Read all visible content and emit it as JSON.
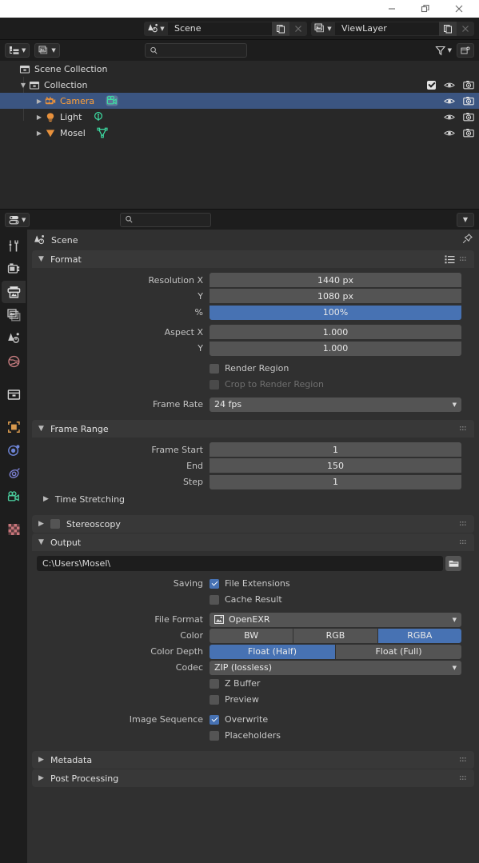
{
  "window": {
    "minimize": "minimize-icon",
    "restore": "restore-icon",
    "close": "close-icon"
  },
  "topbar": {
    "scene": {
      "icon": "scene-icon",
      "name": "Scene",
      "new_btn": "new-scene-icon",
      "unlink_btn": "unlink-icon"
    },
    "viewlayer": {
      "icon": "viewlayer-icon",
      "name": "ViewLayer",
      "new_btn": "new-viewlayer-icon",
      "unlink_btn": "unlink-icon"
    }
  },
  "outliner": {
    "header": {
      "display_mode_icon": "outliner-display-mode-icon",
      "filter_id_icon": "id-type-filter-icon",
      "search_placeholder": "",
      "filter_icon": "funnel-icon",
      "new_collection_icon": "new-collection-icon"
    },
    "rows": [
      {
        "label": "Scene Collection",
        "icon": "scene-collection-icon",
        "indent": 0,
        "selected": false,
        "expand": "",
        "has_checkbox": false,
        "has_eye": false,
        "has_camera": false,
        "data_icon": ""
      },
      {
        "label": "Collection",
        "icon": "collection-icon",
        "indent": 1,
        "selected": false,
        "expand": "down",
        "has_checkbox": true,
        "has_eye": true,
        "has_camera": true,
        "data_icon": ""
      },
      {
        "label": "Camera",
        "icon": "camera-object-icon",
        "indent": 2,
        "selected": true,
        "expand": "right",
        "has_checkbox": false,
        "has_eye": true,
        "has_camera": true,
        "data_icon": "camera-data-icon"
      },
      {
        "label": "Light",
        "icon": "light-object-icon",
        "indent": 2,
        "selected": false,
        "expand": "right",
        "has_checkbox": false,
        "has_eye": true,
        "has_camera": true,
        "data_icon": "light-data-icon"
      },
      {
        "label": "Mosel",
        "icon": "mesh-object-icon",
        "indent": 2,
        "selected": false,
        "expand": "right",
        "has_checkbox": false,
        "has_eye": true,
        "has_camera": true,
        "data_icon": "mesh-data-icon"
      }
    ]
  },
  "properties": {
    "header": {
      "editor_type_icon": "properties-editor-icon",
      "search_placeholder": "",
      "options_icon": "chevron-down-icon"
    },
    "tabs": [
      {
        "name": "tool",
        "icon": "tool-icon",
        "color": "#c8c8c8",
        "active": false
      },
      {
        "name": "render",
        "icon": "render-camera-back-icon",
        "color": "#c8c8c8",
        "active": false
      },
      {
        "name": "output",
        "icon": "printer-icon",
        "color": "#d8d8d8",
        "active": true
      },
      {
        "name": "view-layer",
        "icon": "images-icon",
        "color": "#c8c8c8",
        "active": false
      },
      {
        "name": "scene",
        "icon": "scene-cone-icon",
        "color": "#c8c8c8",
        "active": false
      },
      {
        "name": "world",
        "icon": "world-globe-icon",
        "color": "#c87d80",
        "active": false
      },
      {
        "name": "collection",
        "icon": "collection-box-icon",
        "color": "#d0d0d0",
        "active": false
      },
      {
        "name": "object",
        "icon": "object-square-icon",
        "color": "#d99a4e",
        "active": false
      },
      {
        "name": "modifiers",
        "icon": "physics-orbit-icon",
        "color": "#6d84d6",
        "active": false
      },
      {
        "name": "constraints",
        "icon": "constraint-icon",
        "color": "#7a7fd0",
        "active": false
      },
      {
        "name": "object-data",
        "icon": "camera-data-green-icon",
        "color": "#49c89a",
        "active": false
      },
      {
        "name": "texture",
        "icon": "checker-texture-icon",
        "color": "#c8757a",
        "active": false
      }
    ],
    "breadcrumb": {
      "icon": "scene-cone-icon",
      "label": "Scene",
      "pin_icon": "pin-icon"
    },
    "panels": {
      "format": {
        "title": "Format",
        "open": true,
        "preset_icon": "presets-list-icon",
        "grip_icon": "grip-icon",
        "fields": [
          {
            "label": "Resolution X",
            "value": "1440 px",
            "style": "joined-top"
          },
          {
            "label": "Y",
            "value": "1080 px",
            "style": "joined-mid"
          },
          {
            "label": "%",
            "value": "100%",
            "style": "joined-bot blue"
          },
          {
            "label": "Aspect X",
            "value": "1.000",
            "style": "joined-top"
          },
          {
            "label": "Y",
            "value": "1.000",
            "style": "joined-bot"
          }
        ],
        "checkboxes": [
          {
            "label": "Render Region",
            "checked": false,
            "disabled": false
          },
          {
            "label": "Crop to Render Region",
            "checked": false,
            "disabled": true
          }
        ],
        "frame_rate": {
          "label": "Frame Rate",
          "value": "24 fps"
        }
      },
      "frame_range": {
        "title": "Frame Range",
        "open": true,
        "grip_icon": "grip-icon",
        "fields": [
          {
            "label": "Frame Start",
            "value": "1",
            "style": "joined-top"
          },
          {
            "label": "End",
            "value": "150",
            "style": "joined-mid"
          },
          {
            "label": "Step",
            "value": "1",
            "style": "joined-bot"
          }
        ],
        "subpanel": "Time Stretching"
      },
      "stereoscopy": {
        "title": "Stereoscopy",
        "open": false,
        "checked": false,
        "grip_icon": "grip-icon"
      },
      "output": {
        "title": "Output",
        "open": true,
        "grip_icon": "grip-icon",
        "path": "C:\\Users\\Mosel\\",
        "folder_icon": "folder-icon",
        "saving_label": "Saving",
        "saving": [
          {
            "label": "File Extensions",
            "checked": true
          },
          {
            "label": "Cache Result",
            "checked": false
          }
        ],
        "file_format": {
          "label": "File Format",
          "value": "OpenEXR",
          "icon": "image-file-icon"
        },
        "color": {
          "label": "Color",
          "options": [
            "BW",
            "RGB",
            "RGBA"
          ],
          "selected": "RGBA"
        },
        "color_depth": {
          "label": "Color Depth",
          "options": [
            "Float (Half)",
            "Float (Full)"
          ],
          "selected": "Float (Half)"
        },
        "codec": {
          "label": "Codec",
          "value": "ZIP (lossless)"
        },
        "extra": [
          {
            "label": "Z Buffer",
            "checked": false
          },
          {
            "label": "Preview",
            "checked": false
          }
        ],
        "image_sequence_label": "Image Sequence",
        "image_sequence": [
          {
            "label": "Overwrite",
            "checked": true
          },
          {
            "label": "Placeholders",
            "checked": false
          }
        ]
      },
      "metadata": {
        "title": "Metadata",
        "open": false,
        "grip_icon": "grip-icon"
      },
      "post_processing": {
        "title": "Post Processing",
        "open": false,
        "grip_icon": "grip-icon"
      }
    }
  },
  "colors": {
    "accent_blue": "#4772b3",
    "selection_blue": "#3b5581",
    "active_orange": "#ffa038",
    "panel_bg": "#303030",
    "header_bg": "#1d1d1d"
  }
}
